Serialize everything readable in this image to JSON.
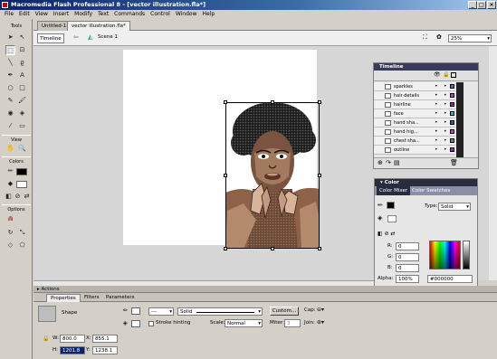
{
  "window": {
    "title": "Macromedia Flash Professional 8 - [vector illustration.fla*]"
  },
  "menu": [
    "File",
    "Edit",
    "View",
    "Insert",
    "Modify",
    "Text",
    "Commands",
    "Control",
    "Window",
    "Help"
  ],
  "tools": {
    "title": "Tools",
    "view": "View",
    "colors": "Colors",
    "options": "Options"
  },
  "doc_tabs": [
    "Untitled-1",
    "vector illustration.fla*"
  ],
  "edit_bar": {
    "timeline_button": "Timeline",
    "scene": "Scene 1",
    "zoom": "25%"
  },
  "timeline": {
    "title": "Timeline",
    "layers": [
      {
        "name": "sparkles",
        "color": "#4a6cd8"
      },
      {
        "name": "hair details",
        "color": "#b040c0"
      },
      {
        "name": "hairline",
        "color": "#a020a0"
      },
      {
        "name": "face",
        "color": "#30b0c0"
      },
      {
        "name": "hand sha...",
        "color": "#3050d0"
      },
      {
        "name": "hand hig...",
        "color": "#c040c0"
      },
      {
        "name": "chest sha...",
        "color": "#808080"
      },
      {
        "name": "outline",
        "color": "#a030b0"
      }
    ]
  },
  "color_panel": {
    "title": "Color",
    "tabs": [
      "Color Mixer",
      "Color Swatches"
    ],
    "type_label": "Type:",
    "type_value": "Solid",
    "r_label": "R:",
    "r_value": "0",
    "g_label": "G:",
    "g_value": "0",
    "b_label": "B:",
    "b_value": "0",
    "alpha_label": "Alpha:",
    "alpha_value": "100%",
    "hex_value": "#000000"
  },
  "actions": {
    "label": "Actions"
  },
  "properties": {
    "tabs": [
      "Properties",
      "Filters",
      "Parameters"
    ],
    "type_label": "Shape",
    "stroke_style": "Solid",
    "custom_button": "Custom...",
    "cap_label": "Cap:",
    "join_label": "Join:",
    "stroke_hinting": "Stroke hinting",
    "scale_label": "Scale:",
    "scale_value": "Normal",
    "miter_label": "Miter:",
    "miter_value": "3",
    "stroke_height": "---",
    "w_label": "W:",
    "w_value": "800.0",
    "x_label": "X:",
    "x_value": "855.1",
    "h_label": "H:",
    "h_value": "1201.8",
    "y_label": "Y:",
    "y_value": "1238.1"
  },
  "colors": {
    "accent": "#0a246a",
    "stage": "#ffffff",
    "workspace": "#d6d6d6"
  }
}
